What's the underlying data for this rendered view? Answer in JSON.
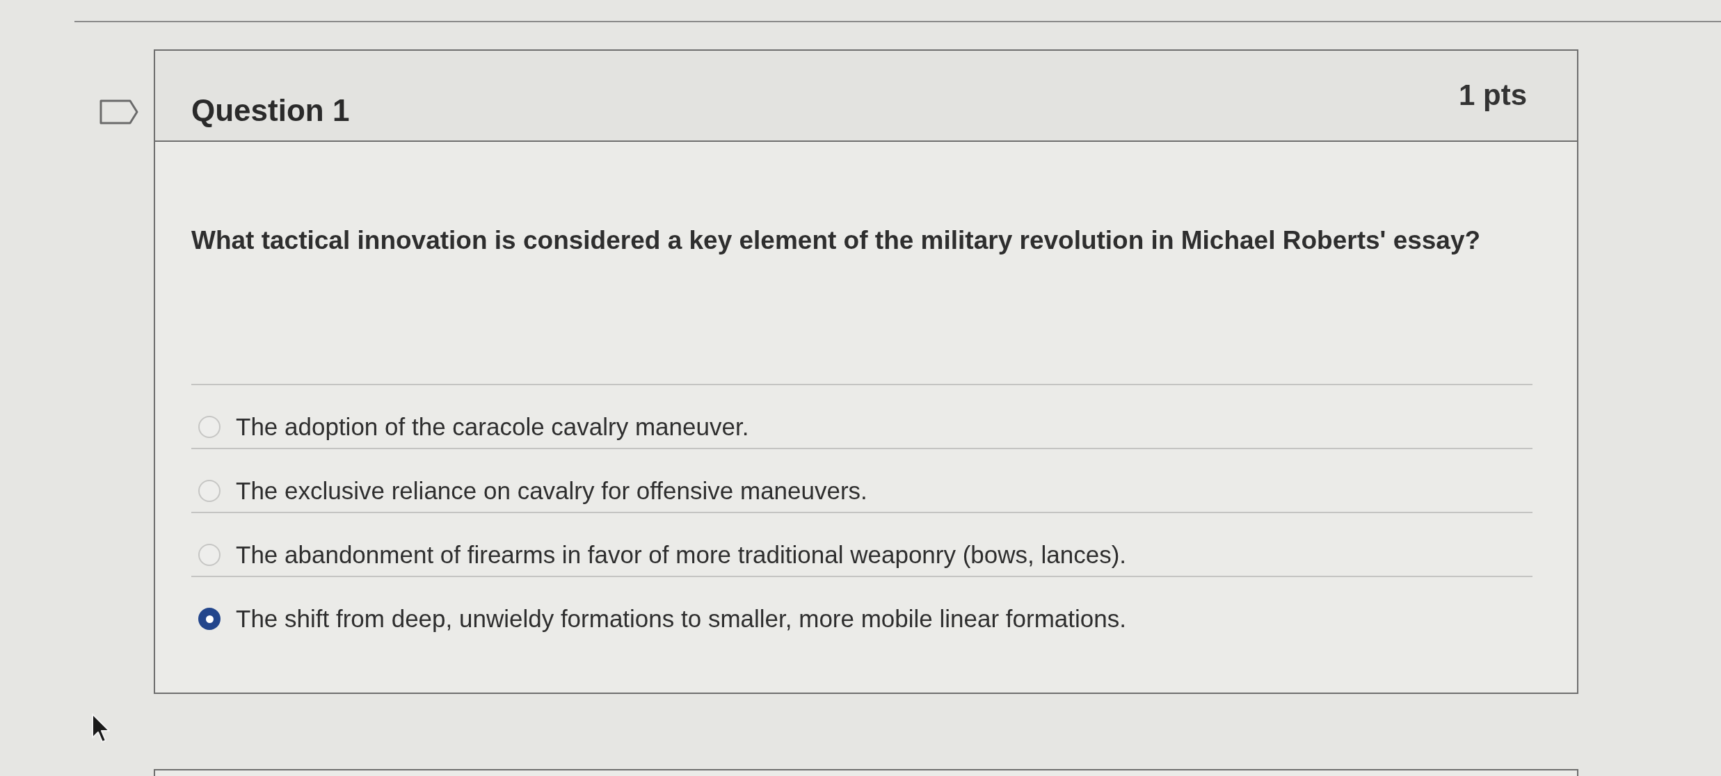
{
  "quiz_question": {
    "title": "Question 1",
    "points": "1 pts",
    "prompt": "What tactical innovation is considered a key element of the military revolution in Michael Roberts' essay?",
    "options": [
      {
        "label": "The adoption of the caracole cavalry maneuver.",
        "selected": false
      },
      {
        "label": "The exclusive reliance on cavalry for offensive maneuvers.",
        "selected": false
      },
      {
        "label": "The abandonment of firearms in favor of more traditional weaponry (bows, lances).",
        "selected": false
      },
      {
        "label": "The shift from deep, unwieldy formations to smaller, more mobile linear formations.",
        "selected": true
      }
    ]
  }
}
